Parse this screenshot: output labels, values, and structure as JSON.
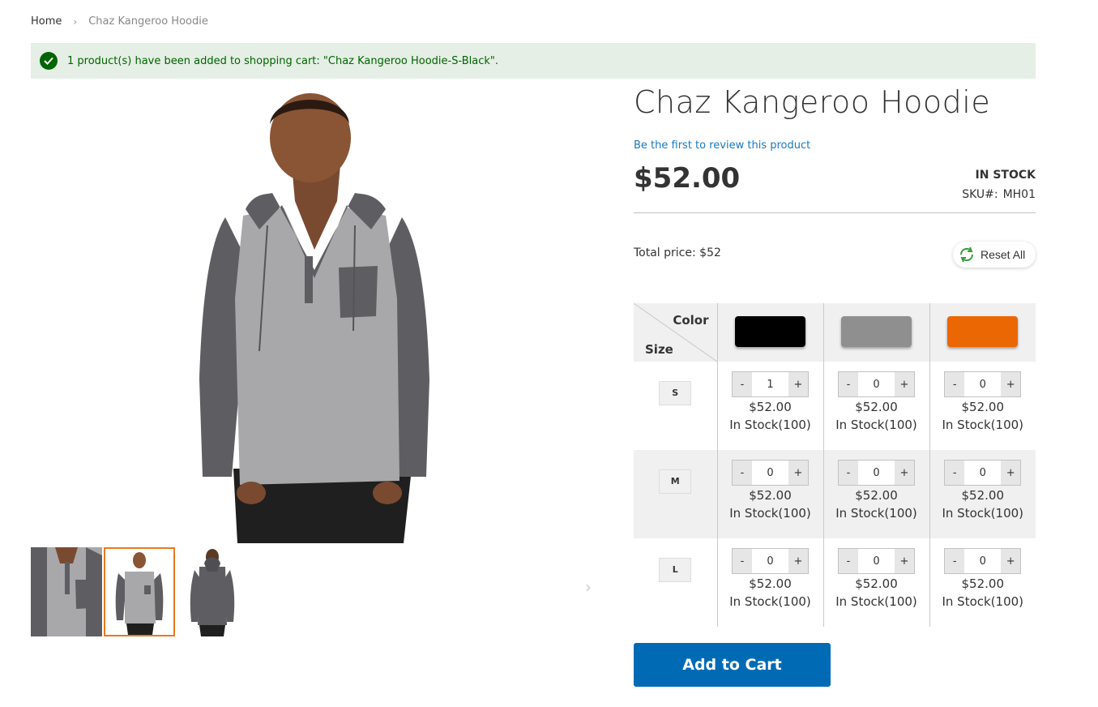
{
  "breadcrumb": {
    "home": "Home",
    "current": "Chaz Kangeroo Hoodie"
  },
  "message": {
    "text": "1 product(s) have been added to shopping cart: \"Chaz Kangeroo Hoodie-S-Black\"."
  },
  "product": {
    "title": "Chaz Kangeroo Hoodie",
    "review_link": "Be the first to review this product",
    "price": "$52.00",
    "stock_status": "IN STOCK",
    "sku_label": "SKU#:",
    "sku_value": "MH01"
  },
  "matrix": {
    "total_price": "Total price: $52",
    "reset_label": "Reset All",
    "color_header": "Color",
    "size_header": "Size",
    "colors": [
      {
        "name": "Black",
        "hex": "#000000"
      },
      {
        "name": "Gray",
        "hex": "#8f8f8f"
      },
      {
        "name": "Orange",
        "hex": "#eb6703"
      }
    ],
    "rows": [
      {
        "size": "S",
        "cells": [
          {
            "qty": "1",
            "price": "$52.00",
            "stock": "In Stock(100)"
          },
          {
            "qty": "0",
            "price": "$52.00",
            "stock": "In Stock(100)"
          },
          {
            "qty": "0",
            "price": "$52.00",
            "stock": "In Stock(100)"
          }
        ]
      },
      {
        "size": "M",
        "cells": [
          {
            "qty": "0",
            "price": "$52.00",
            "stock": "In Stock(100)"
          },
          {
            "qty": "0",
            "price": "$52.00",
            "stock": "In Stock(100)"
          },
          {
            "qty": "0",
            "price": "$52.00",
            "stock": "In Stock(100)"
          }
        ]
      },
      {
        "size": "L",
        "cells": [
          {
            "qty": "0",
            "price": "$52.00",
            "stock": "In Stock(100)"
          },
          {
            "qty": "0",
            "price": "$52.00",
            "stock": "In Stock(100)"
          },
          {
            "qty": "0",
            "price": "$52.00",
            "stock": "In Stock(100)"
          }
        ]
      }
    ],
    "minus_label": "-",
    "plus_label": "+"
  },
  "add_to_cart": {
    "label": "Add to Cart"
  },
  "colors": {
    "accent": "#006bb4",
    "success": "#006400",
    "success_bg": "#e5efe5",
    "thumb_active": "#e87a1e",
    "link": "#1979c3"
  }
}
